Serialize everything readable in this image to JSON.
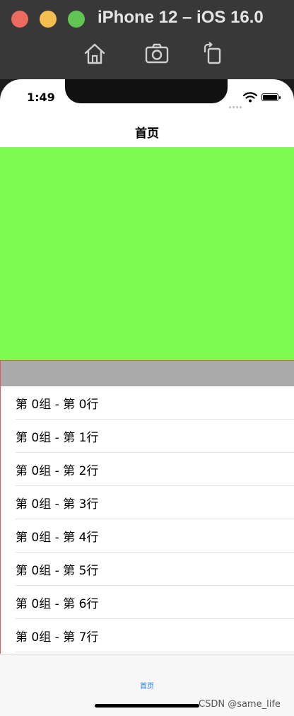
{
  "window": {
    "title": "iPhone 12 – iOS 16.0",
    "toolbar": {
      "home_icon": "home-icon",
      "screenshot_icon": "camera-icon",
      "rotate_icon": "rotate-icon"
    }
  },
  "status_bar": {
    "time": "1:49"
  },
  "nav": {
    "title": "首页"
  },
  "colors": {
    "header_view": "#7efb50",
    "section_header": "#aaaaaa",
    "tab_active": "#1e7cf2",
    "border": "#e85a5a"
  },
  "table": {
    "rows": [
      "第 0组 - 第 0行",
      "第 0组 - 第 1行",
      "第 0组 - 第 2行",
      "第 0组 - 第 3行",
      "第 0组 - 第 4行",
      "第 0组 - 第 5行",
      "第 0组 - 第 6行",
      "第 0组 - 第 7行"
    ]
  },
  "tabbar": {
    "items": [
      "首页"
    ]
  },
  "watermark": "CSDN @same_life"
}
